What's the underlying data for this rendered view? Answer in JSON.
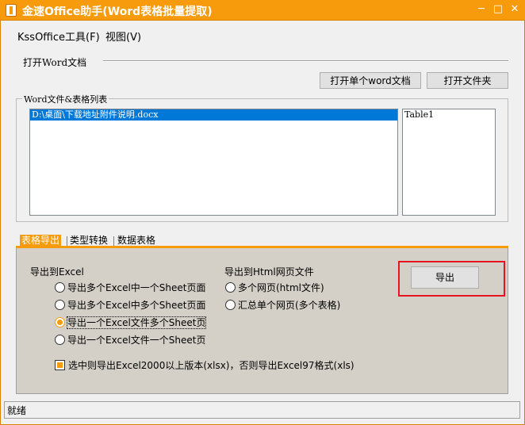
{
  "window": {
    "title": "金速Office助手(Word表格批量提取)",
    "minimize": "─",
    "maximize": "□",
    "close": "✕",
    "accent_color": "#f79a0b"
  },
  "menu": {
    "items": [
      "KssOffice工具(F)",
      "视图(V)"
    ]
  },
  "open_group": {
    "label": "打开Word文档",
    "open_single_button": "打开单个word文档",
    "open_folder_button": "打开文件夹"
  },
  "list_group": {
    "title": "Word文件&表格列表",
    "files": [
      "D:\\桌面\\下载地址附件说明.docx"
    ],
    "tables": [
      "Table1"
    ]
  },
  "tabs": [
    "表格导出",
    "类型转换",
    "数据表格"
  ],
  "export_panel": {
    "excel_label": "导出到Excel",
    "excel_options": [
      {
        "label": "导出多个Excel中一个Sheet页面",
        "checked": false
      },
      {
        "label": "导出多个Excel中多个Sheet页面",
        "checked": false
      },
      {
        "label": "导出一个Excel文件多个Sheet页",
        "checked": true
      },
      {
        "label": "导出一个Excel文件一个Sheet页",
        "checked": false
      }
    ],
    "html_label": "导出到Html网页文件",
    "html_options": [
      {
        "label": "多个网页(html文件)",
        "checked": false
      },
      {
        "label": "汇总单个网页(多个表格)",
        "checked": false
      }
    ],
    "xlsx_checkbox": "选中则导出Excel2000以上版本(xlsx)，否则导出Excel97格式(xls)",
    "export_button": "导出",
    "highlight_color": "#e4151f"
  },
  "status": {
    "text": "就绪"
  }
}
